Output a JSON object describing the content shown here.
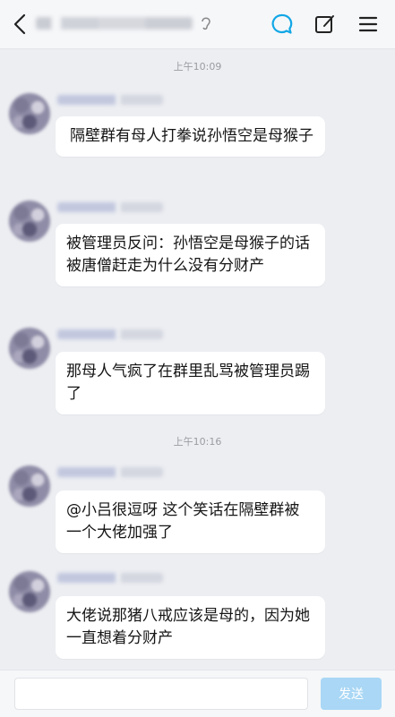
{
  "header": {
    "icons": {
      "back": "chevron-left-icon",
      "title_extra": "ear-icon",
      "chat": "chat-bubble-icon",
      "edit": "edit-icon",
      "menu": "menu-icon"
    },
    "accent_color": "#12a7e6"
  },
  "chat": {
    "messages": [
      {
        "time": "上午10:09"
      },
      {
        "text": "隔壁群有母人打拳说孙悟空是母猴子"
      },
      {
        "text": "被管理员反问：孙悟空是母猴子的话被唐僧赶走为什么没有分财产"
      },
      {
        "text": "那母人气疯了在群里乱骂被管理员踢了"
      },
      {
        "time": "上午10:16"
      },
      {
        "text": "@小吕很逗呀 这个笑话在隔壁群被一个大佬加强了"
      },
      {
        "text": "大佬说那猪八戒应该是母的，因为她一直想着分财产"
      }
    ]
  },
  "composer": {
    "input_value": "",
    "send_label": "发送",
    "send_color": "#a9d7f5"
  }
}
